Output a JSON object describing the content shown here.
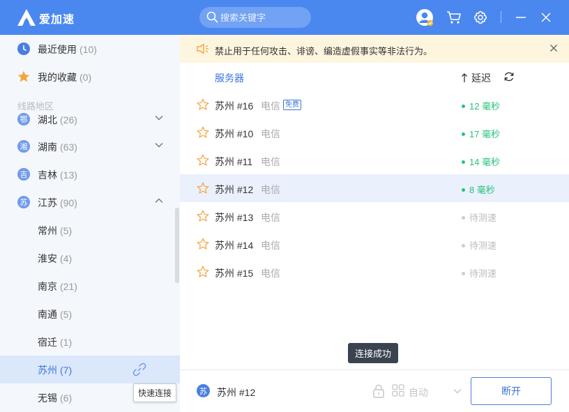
{
  "app": {
    "title": "爱加速"
  },
  "search": {
    "placeholder": "搜索关键字"
  },
  "sidebar": {
    "recent": {
      "label": "最近使用",
      "count": "(10)"
    },
    "favorites": {
      "label": "我的收藏",
      "count": "(0)"
    },
    "section_header": "线路地区",
    "regions": [
      {
        "badge": "鄂",
        "label": "湖北",
        "count": "(26)"
      },
      {
        "badge": "湘",
        "label": "湖南",
        "count": "(63)"
      },
      {
        "badge": "吉",
        "label": "吉林",
        "count": "(13)"
      },
      {
        "badge": "苏",
        "label": "江苏",
        "count": "(90)"
      }
    ],
    "cities": [
      {
        "label": "常州",
        "count": "(5)"
      },
      {
        "label": "淮安",
        "count": "(4)"
      },
      {
        "label": "南京",
        "count": "(21)"
      },
      {
        "label": "南通",
        "count": "(5)"
      },
      {
        "label": "宿迁",
        "count": "(1)"
      },
      {
        "label": "苏州",
        "count": "(7)"
      },
      {
        "label": "无锡",
        "count": "(6)"
      }
    ],
    "tooltip": "快速连接"
  },
  "notice": {
    "text": "禁止用于任何攻击、诽谤、编造虚假事实等非法行为。"
  },
  "list_header": {
    "servers": "服务器",
    "latency": "延迟"
  },
  "servers": [
    {
      "name": "苏州 #16",
      "isp": "电信",
      "badge": "免费",
      "ping": "12 毫秒",
      "status": "ok"
    },
    {
      "name": "苏州 #10",
      "isp": "电信",
      "ping": "17 毫秒",
      "status": "ok"
    },
    {
      "name": "苏州 #11",
      "isp": "电信",
      "ping": "14 毫秒",
      "status": "ok"
    },
    {
      "name": "苏州 #12",
      "isp": "电信",
      "ping": "8 毫秒",
      "status": "ok"
    },
    {
      "name": "苏州 #13",
      "isp": "电信",
      "ping": "待测速",
      "status": "wait"
    },
    {
      "name": "苏州 #14",
      "isp": "电信",
      "ping": "待测速",
      "status": "wait"
    },
    {
      "name": "苏州 #15",
      "isp": "电信",
      "ping": "待测速",
      "status": "wait"
    }
  ],
  "toast": "连接成功",
  "footer": {
    "current_badge": "苏",
    "current_name": "苏州 #12",
    "mode": "自动",
    "disconnect_label": "断开"
  },
  "colors": {
    "brand": "#4a88f0",
    "accent": "#3d74d9",
    "ok": "#27c27a",
    "notice_bg": "#fdf5de"
  }
}
